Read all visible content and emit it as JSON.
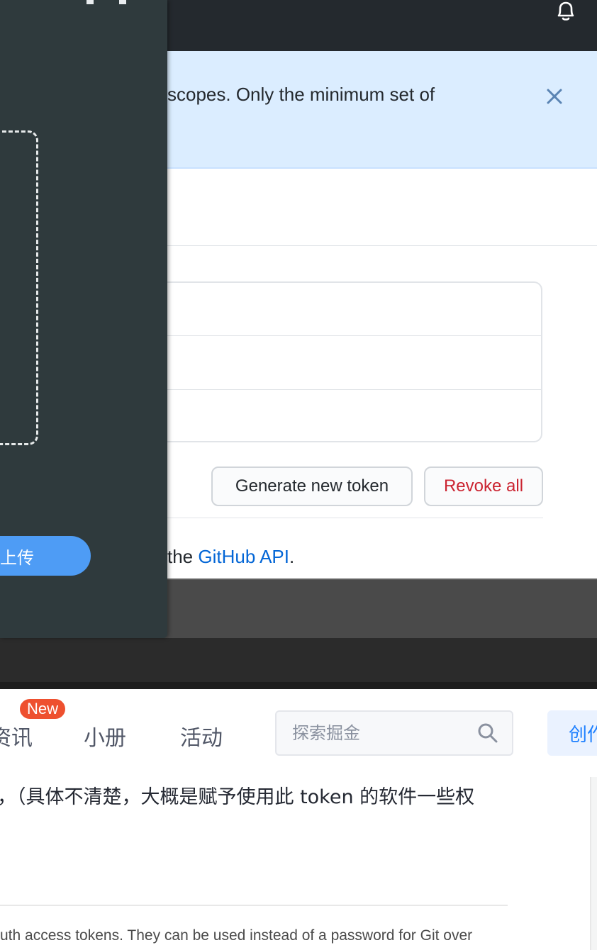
{
  "github": {
    "flash_text": "scopes. Only the minimum set of",
    "buttons": {
      "generate": "Generate new token",
      "revoke": "Revoke all"
    },
    "api_prefix": "the ",
    "api_link": "GitHub API",
    "api_suffix": "."
  },
  "upload_overlay": {
    "upload_label": "上传"
  },
  "juejin": {
    "nav": {
      "zixun": "资讯",
      "new_badge": "New",
      "xiaoce": "小册",
      "huodong": "活动"
    },
    "search": {
      "placeholder": "探索掘金"
    },
    "create_label": "创作"
  },
  "article": {
    "text": "，（具体不清楚，大概是赋予使用此 token 的软件一些权",
    "quote": "uth access tokens. They can be used instead of a password for Git over"
  },
  "colors": {
    "github_header": "#24292e",
    "flash_bg": "#dbedff",
    "revoke_red": "#cb2431",
    "link_blue": "#0366d6",
    "upload_blue": "#4e9cf5",
    "badge_red": "#ee502f",
    "juejin_blue": "#1e80ff"
  }
}
